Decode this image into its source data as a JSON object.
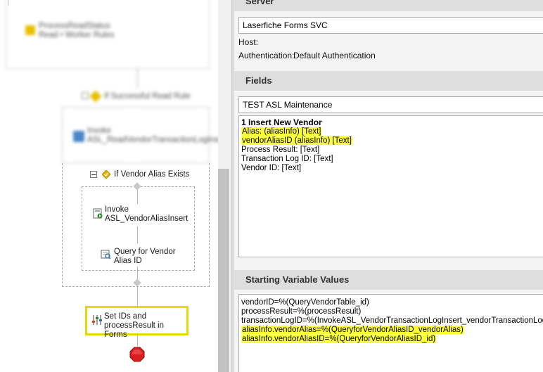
{
  "workflow": {
    "blurred_activity_1": "ProcessReadStatus Read • Worker Rules",
    "blurred_condition": "If Successful Read Rule",
    "blurred_activity_2": "Invoke ASL_ReadVendorTransactionLogInsert",
    "condition_label": "If Vendor Alias Exists",
    "invoke_label": "Invoke ASL_VendorAliasInsert",
    "query_label": "Query for Vendor Alias ID",
    "set_ids_label": "Set IDs and processResult in Forms"
  },
  "server": {
    "header": "Server",
    "server_name": "Laserfiche Forms SVC",
    "host_label": "Host:",
    "host_value": "",
    "auth_label": "Authentication:",
    "auth_value": "Default Authentication"
  },
  "fields": {
    "header": "Fields",
    "form_name": "TEST ASL Maintenance",
    "group_title": "1 Insert  New Vendor",
    "items": [
      {
        "text": "Alias: (aliasInfo) [Text]",
        "highlight": true
      },
      {
        "text": "vendorAliasID (aliasInfo) [Text]",
        "highlight": true
      },
      {
        "text": "Process Result: [Text]",
        "highlight": false
      },
      {
        "text": "Transaction Log ID: [Text]",
        "highlight": false
      },
      {
        "text": "Vendor ID: [Text]",
        "highlight": false
      }
    ]
  },
  "starting_values": {
    "header": "Starting Variable Values",
    "lines": [
      {
        "text": "vendorID=%(QueryVendorTable_id)",
        "highlight": false
      },
      {
        "text": "processResult=%(processResult)",
        "highlight": false
      },
      {
        "text": "transactionLogID=%(InvokeASL_VendorTransactionLogInsert_vendorTransactionLogID)",
        "highlight": false
      },
      {
        "text": "aliasInfo.vendorAlias=%(QueryforVendorAliasID_vendorAlias)",
        "highlight": true
      },
      {
        "text": "aliasInfo.vendorAliasID=%(QueryforVendorAliasID_id)",
        "highlight": true
      }
    ]
  },
  "colors": {
    "highlight": "#ffff3a",
    "selection_border": "#e6d800",
    "stop_red": "#d91e1e"
  }
}
